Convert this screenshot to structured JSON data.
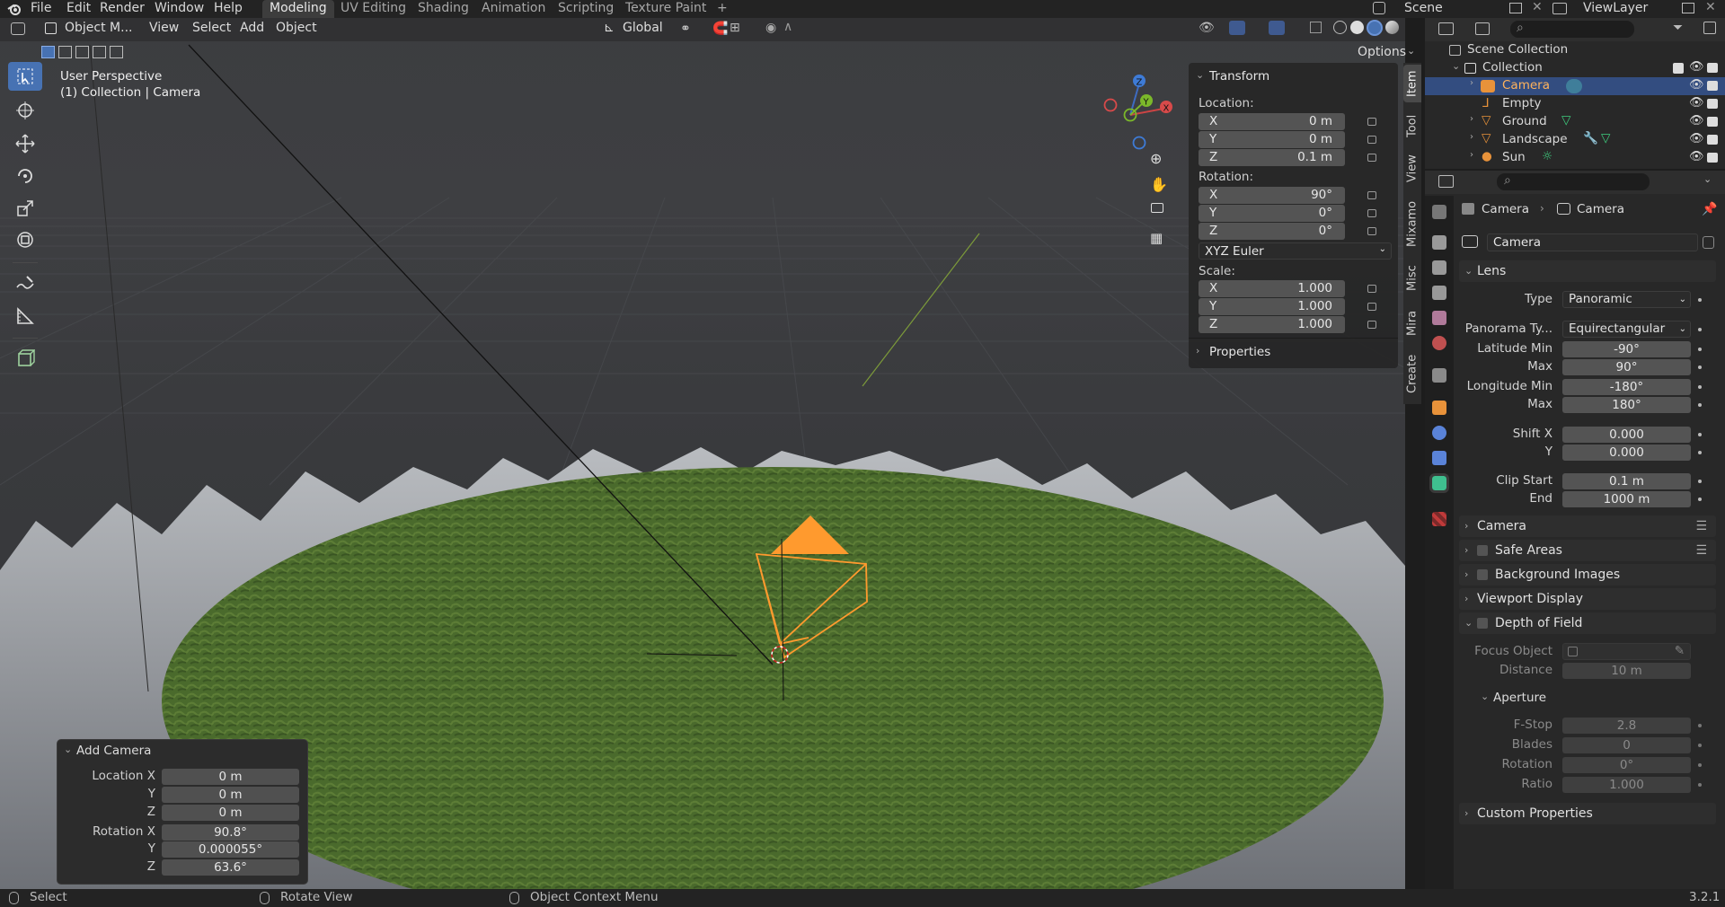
{
  "menu": {
    "items": [
      "File",
      "Edit",
      "Render",
      "Window",
      "Help"
    ]
  },
  "workspaces": {
    "tabs": [
      "Modeling",
      "UV Editing",
      "Shading",
      "Animation",
      "Scripting",
      "Texture Paint"
    ],
    "add": "+",
    "active": "Modeling"
  },
  "scene": {
    "label": "Scene",
    "viewlayer": "ViewLayer"
  },
  "viewport_header": {
    "mode": "Object M...",
    "menus": [
      "View",
      "Select",
      "Add",
      "Object"
    ],
    "orientation": "Global",
    "options": "Options"
  },
  "overlay": {
    "line1": "User Perspective",
    "line2": "(1) Collection | Camera"
  },
  "gizmo": {
    "x": "X",
    "y": "Y",
    "z": "Z"
  },
  "npanel": {
    "tabs": [
      "Item",
      "Tool",
      "View",
      "Mixamo",
      "Misc",
      "Mira",
      "Create"
    ],
    "transform_title": "Transform",
    "location_label": "Location:",
    "location": [
      {
        "axis": "X",
        "value": "0 m"
      },
      {
        "axis": "Y",
        "value": "0 m"
      },
      {
        "axis": "Z",
        "value": "0.1 m"
      }
    ],
    "rotation_label": "Rotation:",
    "rotation": [
      {
        "axis": "X",
        "value": "90°"
      },
      {
        "axis": "Y",
        "value": "0°"
      },
      {
        "axis": "Z",
        "value": "0°"
      }
    ],
    "rotation_mode": "XYZ Euler",
    "scale_label": "Scale:",
    "scale": [
      {
        "axis": "X",
        "value": "1.000"
      },
      {
        "axis": "Y",
        "value": "1.000"
      },
      {
        "axis": "Z",
        "value": "1.000"
      }
    ],
    "properties_title": "Properties"
  },
  "add_camera": {
    "title": "Add Camera",
    "rows": [
      {
        "label": "Location X",
        "value": "0 m"
      },
      {
        "label": "Y",
        "value": "0 m"
      },
      {
        "label": "Z",
        "value": "0 m"
      },
      {
        "label": "Rotation X",
        "value": "90.8°"
      },
      {
        "label": "Y",
        "value": "0.000055°"
      },
      {
        "label": "Z",
        "value": "63.6°"
      }
    ]
  },
  "outliner": {
    "scene_collection": "Scene Collection",
    "collection": "Collection",
    "items": [
      {
        "name": "Camera",
        "color": "#e8923a",
        "selected": true
      },
      {
        "name": "Empty",
        "color": "#e8923a",
        "selected": false
      },
      {
        "name": "Ground",
        "color": "#e8923a",
        "selected": false
      },
      {
        "name": "Landscape",
        "color": "#e8923a",
        "selected": false
      },
      {
        "name": "Sun",
        "color": "#e8923a",
        "selected": false
      }
    ]
  },
  "properties": {
    "breadcrumb": [
      "Camera",
      "Camera"
    ],
    "datablock": "Camera",
    "lens": {
      "title": "Lens",
      "type_label": "Type",
      "type_value": "Panoramic",
      "pano_label": "Panorama Ty...",
      "pano_value": "Equirectangular",
      "lat_min_label": "Latitude Min",
      "lat_min": "-90°",
      "lat_max_label": "Max",
      "lat_max": "90°",
      "lon_min_label": "Longitude Min",
      "lon_min": "-180°",
      "lon_max_label": "Max",
      "lon_max": "180°",
      "shiftx_label": "Shift X",
      "shiftx": "0.000",
      "shifty_label": "Y",
      "shifty": "0.000",
      "clip_start_label": "Clip Start",
      "clip_start": "0.1 m",
      "clip_end_label": "End",
      "clip_end": "1000 m"
    },
    "sections": [
      "Camera",
      "Safe Areas",
      "Background Images",
      "Viewport Display",
      "Depth of Field"
    ],
    "dof": {
      "focus_label": "Focus Object",
      "distance_label": "Distance",
      "distance": "10 m",
      "aperture_title": "Aperture",
      "fstop_label": "F-Stop",
      "fstop": "2.8",
      "blades_label": "Blades",
      "blades": "0",
      "rotation_label": "Rotation",
      "rotation": "0°",
      "ratio_label": "Ratio",
      "ratio": "1.000"
    },
    "custom": "Custom Properties"
  },
  "status": {
    "select": "Select",
    "rotate": "Rotate View",
    "context": "Object Context Menu",
    "version": "3.2.1"
  },
  "colors": {
    "accent": "#4772b3",
    "selected_row": "#334d80",
    "camera_orange": "#ff9a2e"
  }
}
